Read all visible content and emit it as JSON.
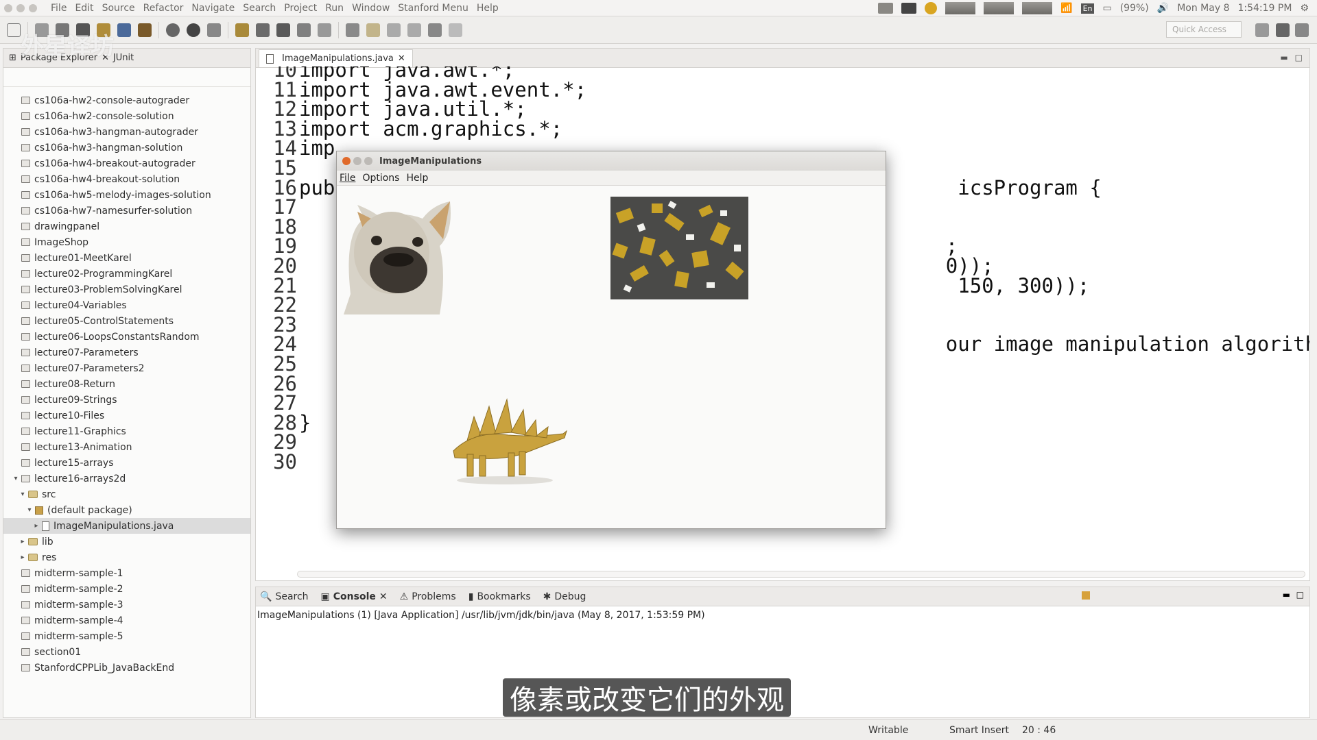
{
  "menubar": {
    "items": [
      "File",
      "Edit",
      "Source",
      "Refactor",
      "Navigate",
      "Search",
      "Project",
      "Run",
      "Window",
      "Stanford Menu",
      "Help"
    ],
    "battery": "(99%)",
    "date": "Mon May 8",
    "time": "1:54:19 PM",
    "lang": "En"
  },
  "toolbar": {
    "quick_access_placeholder": "Quick Access"
  },
  "package_explorer": {
    "title": "Package Explorer",
    "second_tab": "JUnit",
    "items": [
      {
        "label": "cs106a-hw2-console-autograder",
        "kind": "project",
        "level": 0
      },
      {
        "label": "cs106a-hw2-console-solution",
        "kind": "project",
        "level": 0
      },
      {
        "label": "cs106a-hw3-hangman-autograder",
        "kind": "project",
        "level": 0
      },
      {
        "label": "cs106a-hw3-hangman-solution",
        "kind": "project",
        "level": 0
      },
      {
        "label": "cs106a-hw4-breakout-autograder",
        "kind": "project",
        "level": 0
      },
      {
        "label": "cs106a-hw4-breakout-solution",
        "kind": "project",
        "level": 0
      },
      {
        "label": "cs106a-hw5-melody-images-solution",
        "kind": "project",
        "level": 0
      },
      {
        "label": "cs106a-hw7-namesurfer-solution",
        "kind": "project",
        "level": 0
      },
      {
        "label": "drawingpanel",
        "kind": "project",
        "level": 0
      },
      {
        "label": "ImageShop",
        "kind": "project",
        "level": 0
      },
      {
        "label": "lecture01-MeetKarel",
        "kind": "project",
        "level": 0
      },
      {
        "label": "lecture02-ProgrammingKarel",
        "kind": "project",
        "level": 0
      },
      {
        "label": "lecture03-ProblemSolvingKarel",
        "kind": "project",
        "level": 0
      },
      {
        "label": "lecture04-Variables",
        "kind": "project",
        "level": 0
      },
      {
        "label": "lecture05-ControlStatements",
        "kind": "project",
        "level": 0
      },
      {
        "label": "lecture06-LoopsConstantsRandom",
        "kind": "project",
        "level": 0
      },
      {
        "label": "lecture07-Parameters",
        "kind": "project",
        "level": 0
      },
      {
        "label": "lecture07-Parameters2",
        "kind": "project",
        "level": 0
      },
      {
        "label": "lecture08-Return",
        "kind": "project",
        "level": 0
      },
      {
        "label": "lecture09-Strings",
        "kind": "project",
        "level": 0
      },
      {
        "label": "lecture10-Files",
        "kind": "project",
        "level": 0
      },
      {
        "label": "lecture11-Graphics",
        "kind": "project",
        "level": 0
      },
      {
        "label": "lecture13-Animation",
        "kind": "project",
        "level": 0
      },
      {
        "label": "lecture15-arrays",
        "kind": "project",
        "level": 0
      },
      {
        "label": "lecture16-arrays2d",
        "kind": "project-open",
        "level": 0
      },
      {
        "label": "src",
        "kind": "folder-open",
        "level": 1
      },
      {
        "label": "(default package)",
        "kind": "package-open",
        "level": 2
      },
      {
        "label": "ImageManipulations.java",
        "kind": "file",
        "level": 3,
        "selected": true
      },
      {
        "label": "lib",
        "kind": "folder",
        "level": 1
      },
      {
        "label": "res",
        "kind": "folder",
        "level": 1
      },
      {
        "label": "midterm-sample-1",
        "kind": "project",
        "level": 0
      },
      {
        "label": "midterm-sample-2",
        "kind": "project",
        "level": 0
      },
      {
        "label": "midterm-sample-3",
        "kind": "project",
        "level": 0
      },
      {
        "label": "midterm-sample-4",
        "kind": "project",
        "level": 0
      },
      {
        "label": "midterm-sample-5",
        "kind": "project",
        "level": 0
      },
      {
        "label": "section01",
        "kind": "project",
        "level": 0
      },
      {
        "label": "StanfordCPPLib_JavaBackEnd",
        "kind": "project",
        "level": 0
      }
    ]
  },
  "editor": {
    "tab_label": "ImageManipulations.java",
    "lines": [
      {
        "n": "10",
        "text": "import java.awt.*;"
      },
      {
        "n": "11",
        "text": "import java.awt.event.*;"
      },
      {
        "n": "12",
        "text": "import java.util.*;"
      },
      {
        "n": "13",
        "text": "import acm.graphics.*;"
      },
      {
        "n": "14",
        "text": "imp"
      },
      {
        "n": "15",
        "text": ""
      },
      {
        "n": "16",
        "text": "pub                                                    icsProgram {"
      },
      {
        "n": "17",
        "text": ""
      },
      {
        "n": "18",
        "text": ""
      },
      {
        "n": "19",
        "text": "                                                      ;"
      },
      {
        "n": "20",
        "text": "                                                      0));"
      },
      {
        "n": "21",
        "text": "                                                       150, 300));"
      },
      {
        "n": "22",
        "text": ""
      },
      {
        "n": "23",
        "text": ""
      },
      {
        "n": "24",
        "text": "                                                      our image manipulation algorithm"
      },
      {
        "n": "25",
        "text": ""
      },
      {
        "n": "26",
        "text": ""
      },
      {
        "n": "27",
        "text": ""
      },
      {
        "n": "28",
        "text": "}"
      },
      {
        "n": "29",
        "text": ""
      },
      {
        "n": "30",
        "text": ""
      }
    ]
  },
  "java_window": {
    "title": "ImageManipulations",
    "menu": [
      "File",
      "Options",
      "Help"
    ]
  },
  "bottom_panel": {
    "tabs": [
      "Search",
      "Console",
      "Problems",
      "Bookmarks",
      "Debug"
    ],
    "active_tab": "Console",
    "description": "ImageManipulations (1) [Java Application] /usr/lib/jvm/jdk/bin/java (May 8, 2017, 1:53:59 PM)"
  },
  "statusbar": {
    "writable": "Writable",
    "insert_mode": "Smart Insert",
    "position": "20 : 46"
  },
  "subtitle": "像素或改变它们的外观",
  "watermark": "外星译坊"
}
